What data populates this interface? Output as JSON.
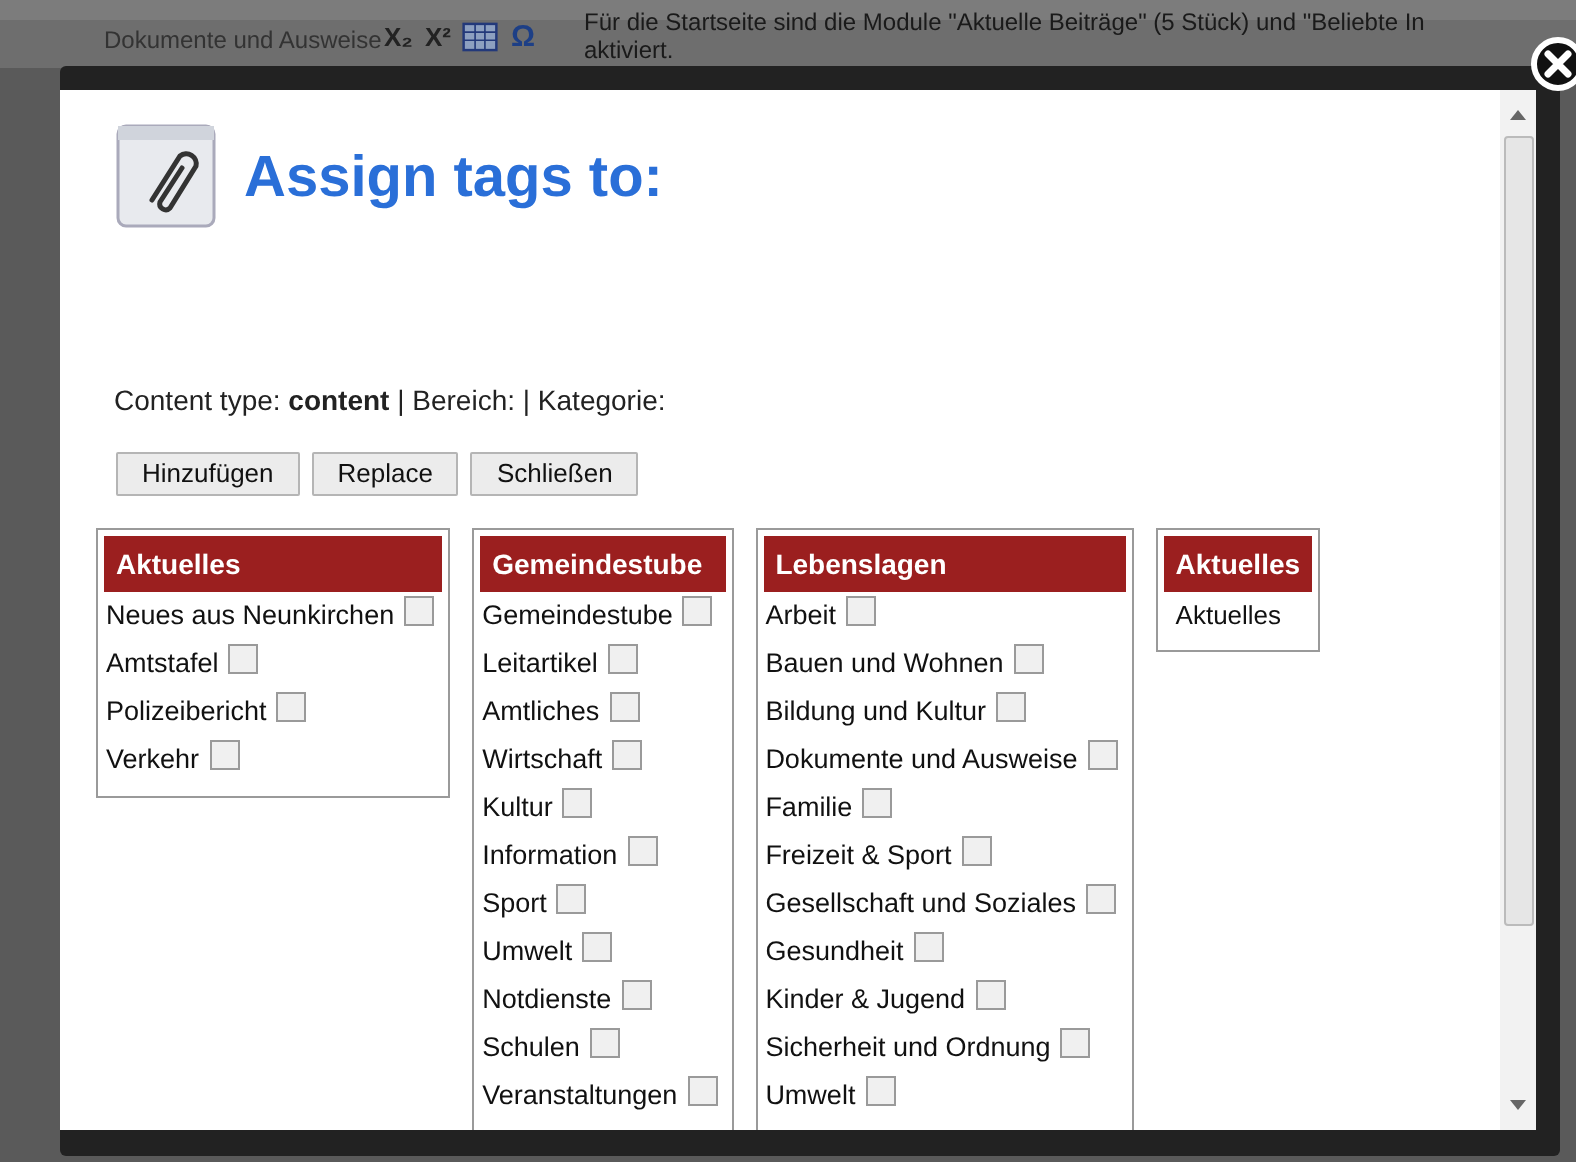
{
  "background": {
    "sidebar_items": [
      "Dokumente und Ausweise"
    ],
    "toolbar": [
      "X₂",
      "X²",
      "Ω"
    ],
    "article_lines": [
      "Für die Startseite sind die Module \"Aktuelle Beiträge\" (5 Stück) und \"Beliebte In",
      "aktiviert."
    ]
  },
  "dialog": {
    "title": "Assign tags to:",
    "info": "Content type: **content** | Bereich: | Kategorie:",
    "buttons": [
      "Hinzufügen",
      "Replace",
      "Schließen"
    ],
    "groups": [
      {
        "title": "Aktuelles",
        "items": [
          {
            "label": "Neues aus Neunkirchen",
            "checked": false
          },
          {
            "label": "Amtstafel",
            "checked": false
          },
          {
            "label": "Polizeibericht",
            "checked": false
          },
          {
            "label": "Verkehr",
            "checked": false
          }
        ]
      },
      {
        "title": "Gemeindestube",
        "items": [
          {
            "label": "Gemeindestube",
            "checked": false
          },
          {
            "label": "Leitartikel",
            "checked": false
          },
          {
            "label": "Amtliches",
            "checked": false
          },
          {
            "label": "Wirtschaft",
            "checked": false
          },
          {
            "label": "Kultur",
            "checked": false
          },
          {
            "label": "Information",
            "checked": false
          },
          {
            "label": "Sport",
            "checked": false
          },
          {
            "label": "Umwelt",
            "checked": false
          },
          {
            "label": "Notdienste",
            "checked": false
          },
          {
            "label": "Schulen",
            "checked": false
          },
          {
            "label": "Veranstaltungen",
            "checked": false
          }
        ]
      },
      {
        "title": "Lebenslagen",
        "items": [
          {
            "label": "Arbeit",
            "checked": false
          },
          {
            "label": "Bauen und Wohnen",
            "checked": false
          },
          {
            "label": "Bildung und Kultur",
            "checked": false
          },
          {
            "label": "Dokumente und Ausweise",
            "checked": false
          },
          {
            "label": "Familie",
            "checked": false
          },
          {
            "label": "Freizeit & Sport",
            "checked": false
          },
          {
            "label": "Gesellschaft und Soziales",
            "checked": false
          },
          {
            "label": "Gesundheit",
            "checked": false
          },
          {
            "label": "Kinder & Jugend",
            "checked": false
          },
          {
            "label": "Sicherheit und Ordnung",
            "checked": false
          },
          {
            "label": "Umwelt",
            "checked": false
          }
        ]
      },
      {
        "title": "Aktuelles",
        "items": [
          {
            "label": "Aktuelles",
            "kind": "plain"
          }
        ]
      }
    ]
  }
}
